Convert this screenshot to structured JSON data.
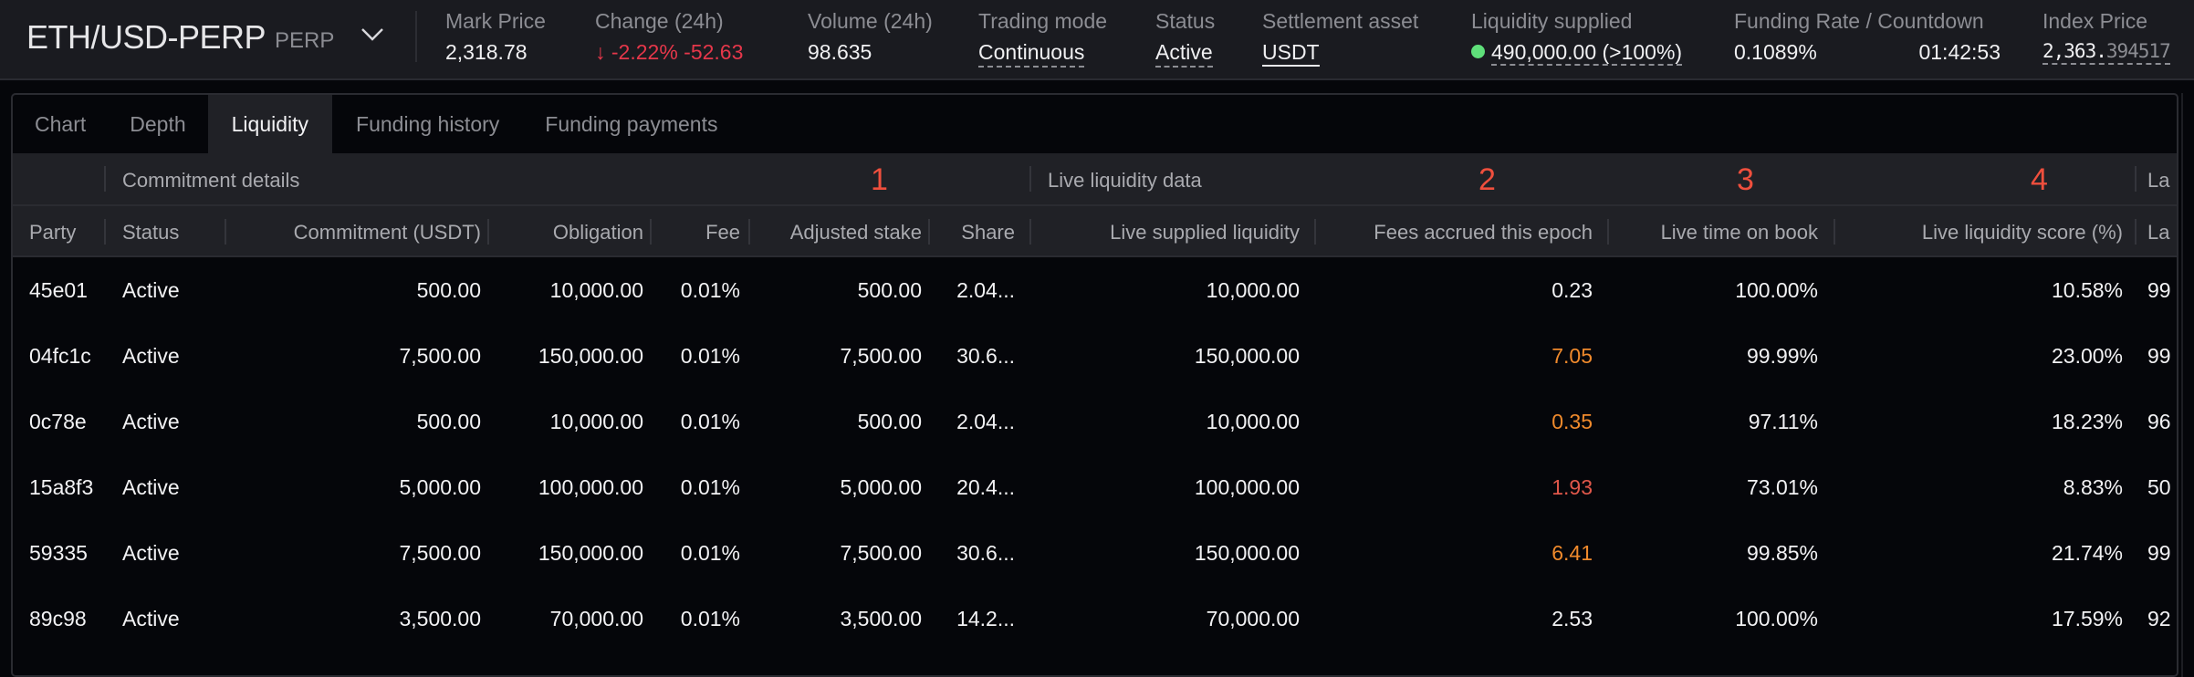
{
  "header": {
    "market_name": "ETH/USD-PERP",
    "market_tag": "PERP",
    "chevron_icon": "chevron-down-icon",
    "stats": {
      "mark_price": {
        "label": "Mark Price",
        "value": "2,318.78"
      },
      "change_24h": {
        "label": "Change (24h)",
        "arrow": "↓",
        "percent": "-2.22%",
        "absolute": "-52.63"
      },
      "volume_24h": {
        "label": "Volume (24h)",
        "value": "98.635"
      },
      "trading_mode": {
        "label": "Trading mode",
        "value": "Continuous"
      },
      "status": {
        "label": "Status",
        "value": "Active"
      },
      "settlement_asset": {
        "label": "Settlement asset",
        "value": "USDT"
      },
      "liquidity_supplied": {
        "label": "Liquidity supplied",
        "value": "490,000.00 (>100%)",
        "indicator_color": "#5fe07a"
      },
      "funding": {
        "label": "Funding Rate / Countdown",
        "rate": "0.1089%",
        "countdown": "01:42:53"
      },
      "index_price": {
        "label": "Index Price",
        "value_main": "2,363.",
        "value_decimals": "394517"
      }
    }
  },
  "tabs": [
    {
      "label": "Chart",
      "active": false
    },
    {
      "label": "Depth",
      "active": false
    },
    {
      "label": "Liquidity",
      "active": true
    },
    {
      "label": "Funding history",
      "active": false
    },
    {
      "label": "Funding payments",
      "active": false
    }
  ],
  "table": {
    "groups": {
      "commitment": "Commitment details",
      "live": "Live liquidity data",
      "last": "La"
    },
    "annotations": [
      "1",
      "2",
      "3",
      "4"
    ],
    "columns": [
      "Party",
      "Status",
      "Commitment (USDT)",
      "Obligation",
      "Fee",
      "Adjusted stake",
      "Share",
      "Live supplied liquidity",
      "Fees accrued this epoch",
      "Live time on book",
      "Live liquidity score (%)",
      "La"
    ],
    "rows": [
      {
        "party": "45e01",
        "status": "Active",
        "commitment": "500.00",
        "obligation": "10,000.00",
        "fee": "0.01%",
        "adjusted_stake": "500.00",
        "share": "2.04...",
        "live_supplied": "10,000.00",
        "fees_accrued": "0.23",
        "fees_color": "default",
        "time_on_book": "100.00%",
        "score": "10.58%",
        "last": "99"
      },
      {
        "party": "04fc1c",
        "status": "Active",
        "commitment": "7,500.00",
        "obligation": "150,000.00",
        "fee": "0.01%",
        "adjusted_stake": "7,500.00",
        "share": "30.6...",
        "live_supplied": "150,000.00",
        "fees_accrued": "7.05",
        "fees_color": "orange",
        "time_on_book": "99.99%",
        "score": "23.00%",
        "last": "99"
      },
      {
        "party": "0c78e",
        "status": "Active",
        "commitment": "500.00",
        "obligation": "10,000.00",
        "fee": "0.01%",
        "adjusted_stake": "500.00",
        "share": "2.04...",
        "live_supplied": "10,000.00",
        "fees_accrued": "0.35",
        "fees_color": "orange",
        "time_on_book": "97.11%",
        "score": "18.23%",
        "last": "96"
      },
      {
        "party": "15a8f3",
        "status": "Active",
        "commitment": "5,000.00",
        "obligation": "100,000.00",
        "fee": "0.01%",
        "adjusted_stake": "5,000.00",
        "share": "20.4...",
        "live_supplied": "100,000.00",
        "fees_accrued": "1.93",
        "fees_color": "red",
        "time_on_book": "73.01%",
        "score": "8.83%",
        "last": "50"
      },
      {
        "party": "59335",
        "status": "Active",
        "commitment": "7,500.00",
        "obligation": "150,000.00",
        "fee": "0.01%",
        "adjusted_stake": "7,500.00",
        "share": "30.6...",
        "live_supplied": "150,000.00",
        "fees_accrued": "6.41",
        "fees_color": "orange",
        "time_on_book": "99.85%",
        "score": "21.74%",
        "last": "99"
      },
      {
        "party": "89c98",
        "status": "Active",
        "commitment": "3,500.00",
        "obligation": "70,000.00",
        "fee": "0.01%",
        "adjusted_stake": "3,500.00",
        "share": "14.2...",
        "live_supplied": "70,000.00",
        "fees_accrued": "2.53",
        "fees_color": "default",
        "time_on_book": "100.00%",
        "score": "17.59%",
        "last": "92"
      }
    ]
  },
  "colors": {
    "negative": "#e5374a",
    "fee_orange": "#f08a2c",
    "fee_red": "#e0574a",
    "annotation": "#ef4f3d",
    "indicator_green": "#5fe07a"
  }
}
